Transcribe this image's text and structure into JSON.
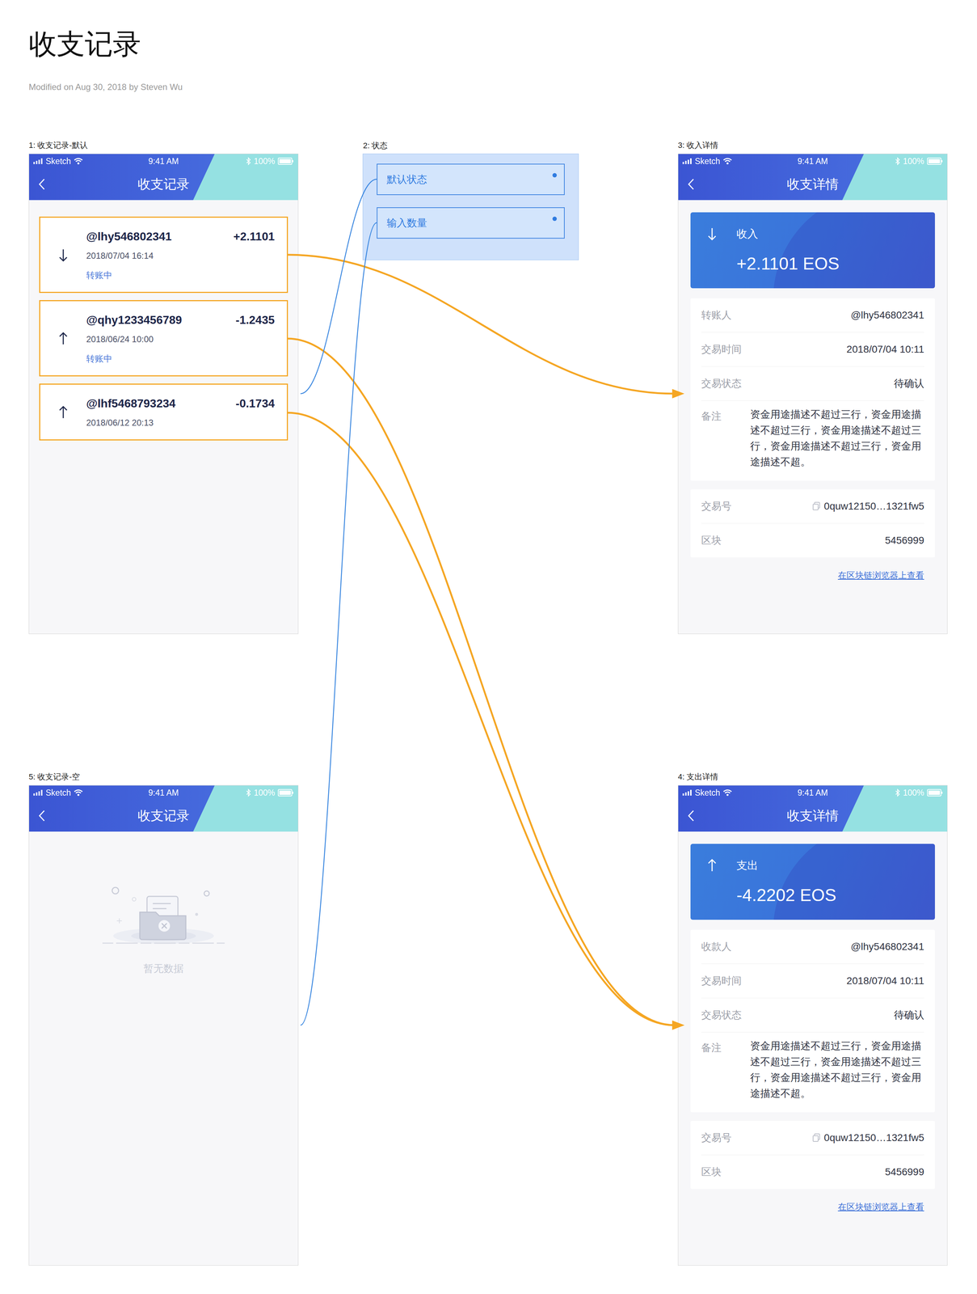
{
  "page": {
    "title": "收支记录",
    "meta": "Modified on Aug 30, 2018 by Steven Wu"
  },
  "status_bar": {
    "carrier": "Sketch",
    "time": "9:41 AM",
    "battery": "100%"
  },
  "list_default": {
    "label": "1: 收支记录-默认",
    "nav_title": "收支记录",
    "items": [
      {
        "name": "@lhy546802341",
        "date": "2018/07/04 16:14",
        "amount": "+2.1101",
        "status": "转账中",
        "kind": "in"
      },
      {
        "name": "@qhy1233456789",
        "date": "2018/06/24 10:00",
        "amount": "-1.2435",
        "status": "转账中",
        "kind": "out"
      },
      {
        "name": "@lhf5468793234",
        "date": "2018/06/12 20:13",
        "amount": "-0.1734",
        "kind": "out"
      }
    ]
  },
  "states": {
    "label": "2: 状态",
    "items": [
      "默认状态",
      "输入数量"
    ]
  },
  "income_detail": {
    "label": "3: 收入详情",
    "nav_title": "收支详情",
    "kind": "in",
    "type": "收入",
    "amount": "+2.1101 EOS",
    "rows": [
      {
        "label": "转账人",
        "value": "@lhy546802341"
      },
      {
        "label": "交易时间",
        "value": "2018/07/04 10:11"
      },
      {
        "label": "交易状态",
        "value": "待确认"
      }
    ],
    "remark": {
      "label": "备注",
      "value": "资金用途描述不超过三行，资金用途描述不超过三行，资金用途描述不超过三行，资金用途描述不超过三行，资金用途描述不超。"
    },
    "chain_rows": [
      {
        "label": "交易号",
        "value": "0quw12150…1321fw5",
        "copyable": true
      },
      {
        "label": "区块",
        "value": "5456999",
        "copyable": false
      }
    ],
    "link": "在区块链浏览器上查看"
  },
  "expense_detail": {
    "label": "4: 支出详情",
    "nav_title": "收支详情",
    "kind": "out",
    "type": "支出",
    "amount": "-4.2202 EOS",
    "rows": [
      {
        "label": "收款人",
        "value": "@lhy546802341"
      },
      {
        "label": "交易时间",
        "value": "2018/07/04 10:11"
      },
      {
        "label": "交易状态",
        "value": "待确认"
      }
    ],
    "remark": {
      "label": "备注",
      "value": "资金用途描述不超过三行，资金用途描述不超过三行，资金用途描述不超过三行，资金用途描述不超过三行，资金用途描述不超。"
    },
    "chain_rows": [
      {
        "label": "交易号",
        "value": "0quw12150…1321fw5",
        "copyable": true
      },
      {
        "label": "区块",
        "value": "5456999",
        "copyable": false
      }
    ],
    "link": "在区块链浏览器上查看"
  },
  "list_empty": {
    "label": "5: 收支记录-空",
    "nav_title": "收支记录",
    "empty_text": "暂无数据"
  },
  "links": [
    {
      "from": "@lhy546802341",
      "to": "3: 收入详情",
      "kind": "arrow",
      "color": "#f5a623"
    },
    {
      "from": "@qhy1233456789",
      "to": "4: 支出详情",
      "kind": "arrow",
      "color": "#f5a623"
    },
    {
      "from": "@lhf5468793234",
      "to": "4: 支出详情",
      "kind": "arrow",
      "color": "#f5a623"
    },
    {
      "from": "默认状态",
      "to": "1: 收支记录-默认",
      "kind": "line",
      "color": "#3a87e0"
    },
    {
      "from": "输入数量",
      "to": "5: 收支记录-空",
      "kind": "line",
      "color": "#3a87e0"
    }
  ]
}
